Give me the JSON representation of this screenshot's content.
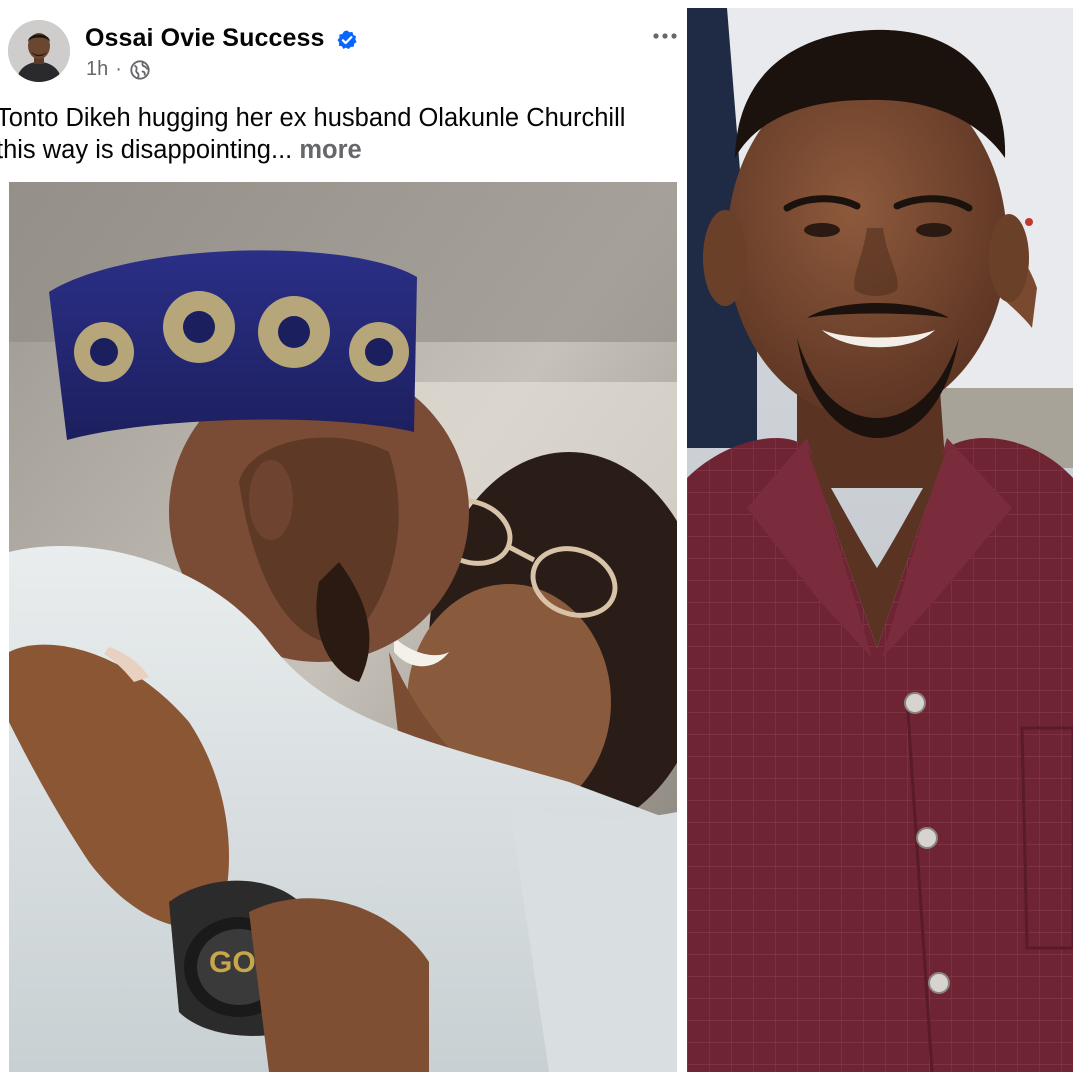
{
  "post": {
    "author": {
      "name": "Ossai Ovie Success",
      "verified": true,
      "verified_icon": "verified-badge-icon"
    },
    "meta": {
      "time": "1h",
      "separator": "·",
      "audience_icon": "globe-icon"
    },
    "options_icon": "more-horizontal-icon",
    "text": {
      "line1": "Tonto Dikeh hugging her ex husband Olakunle Churchill",
      "line2": "this way is disappointing...",
      "more_label": "more"
    },
    "photo": {
      "watermark": "GO"
    }
  },
  "colors": {
    "name": "#050505",
    "meta": "#65676b",
    "verified_badge": "#0866ff",
    "more_link": "#65676b"
  }
}
